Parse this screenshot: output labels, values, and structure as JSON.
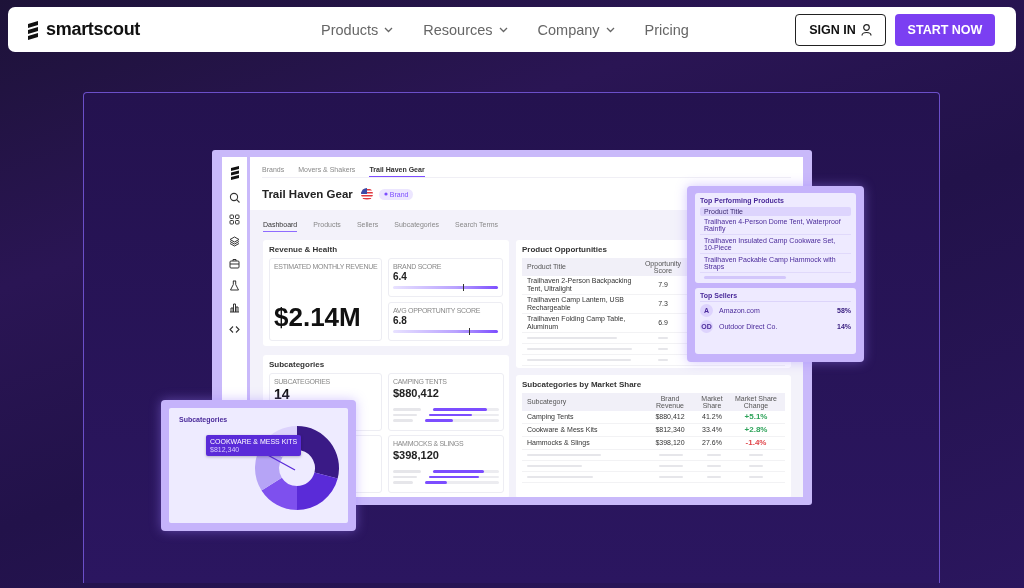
{
  "nav": {
    "logo": "smartscout",
    "menu": [
      {
        "label": "Products",
        "has_menu": true
      },
      {
        "label": "Resources",
        "has_menu": true
      },
      {
        "label": "Company",
        "has_menu": true
      },
      {
        "label": "Pricing",
        "has_menu": false
      }
    ],
    "sign_in": "SIGN IN",
    "start_now": "START NOW"
  },
  "app": {
    "breadcrumbs": [
      {
        "label": "Brands",
        "selected": false
      },
      {
        "label": "Movers & Shakers",
        "selected": false
      },
      {
        "label": "Trail Haven Gear",
        "selected": true
      }
    ],
    "title": "Trail Haven Gear",
    "badge": "Brand",
    "tabs": [
      {
        "label": "Dashboard",
        "selected": true
      },
      {
        "label": "Products",
        "selected": false
      },
      {
        "label": "Sellers",
        "selected": false
      },
      {
        "label": "Subcategories",
        "selected": false
      },
      {
        "label": "Search Terms",
        "selected": false
      }
    ],
    "revenue": {
      "title": "Revenue & Health",
      "revenue_label": "ESTIMATED MONTHLY REVENUE",
      "revenue_value": "$2.14M",
      "scores": [
        {
          "label": "BRAND SCORE",
          "value": "6.4",
          "level": 0.67
        },
        {
          "label": "AVG OPPORTUNITY SCORE",
          "value": "6.8",
          "level": 0.72
        }
      ]
    },
    "subcategories": {
      "title": "Subcategories",
      "tiles": [
        {
          "kind": "count",
          "label": "SUBCATEGORIES",
          "value": "14"
        },
        {
          "kind": "bars",
          "label": "CAMPING TENTS",
          "value": "$880,412",
          "bars": [
            {
              "level": 0.82
            },
            {
              "level": 0.62
            },
            {
              "level": 0.38
            }
          ]
        },
        {
          "kind": "bars",
          "label": "HAMMOCKS & SLINGS",
          "value": "$398,120",
          "bars": [
            {
              "level": 0.78
            },
            {
              "level": 0.72
            },
            {
              "level": 0.3
            }
          ]
        }
      ]
    },
    "opportunities": {
      "title": "Product Opportunities",
      "columns": [
        "Product Title",
        "Opportunity Score"
      ],
      "rows": [
        {
          "title": "Trailhaven 2-Person Backpacking Tent, Ultralight",
          "score": "7.9"
        },
        {
          "title": "Trailhaven Camp Lantern, USB Rechargeable",
          "score": "7.3"
        },
        {
          "title": "Trailhaven Folding Camp Table, Aluminum",
          "score": "6.9"
        }
      ]
    },
    "market_share": {
      "title": "Subcategories by Market Share",
      "columns": [
        "Subcategory",
        "Brand Revenue",
        "Market Share",
        "Market Share Change"
      ],
      "rows": [
        {
          "subcategory": "Camping Tents",
          "revenue": "$880,412",
          "share": "41.2%",
          "change": "+5.1%",
          "color": "#2ea35a"
        },
        {
          "subcategory": "Cookware & Mess Kits",
          "revenue": "$812,340",
          "share": "33.4%",
          "change": "+2.8%",
          "color": "#2ea35a"
        },
        {
          "subcategory": "Hammocks & Slings",
          "revenue": "$398,120",
          "share": "27.6%",
          "change": "-1.4%",
          "color": "#e0454a"
        }
      ]
    }
  },
  "top_products": {
    "title": "Top Performing Products",
    "column": "Product Title",
    "rows": [
      "Trailhaven 4-Person Dome Tent, Waterproof Rainfly",
      "Trailhaven Insulated Camp Cookware Set, 10-Piece",
      "Trailhaven Packable Camp Hammock with Straps"
    ]
  },
  "top_sellers": {
    "title": "Top Sellers",
    "rows": [
      {
        "initials": "A",
        "name": "Amazon.com",
        "share": "58%"
      },
      {
        "initials": "OD",
        "name": "Outdoor Direct Co.",
        "share": "14%"
      }
    ]
  },
  "subcategory_chart": {
    "title": "Subcategories",
    "tooltip_label": "COOKWARE & MESS KITS",
    "tooltip_value": "$812,340"
  }
}
